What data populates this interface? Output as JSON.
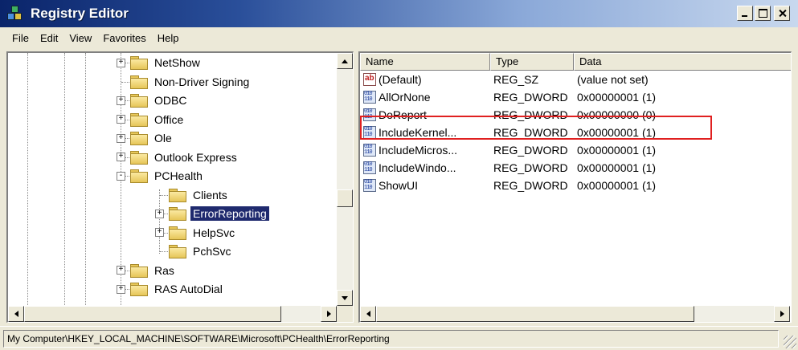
{
  "window": {
    "title": "Registry Editor"
  },
  "menu": [
    "File",
    "Edit",
    "View",
    "Favorites",
    "Help"
  ],
  "tree": {
    "items": [
      {
        "label": "NetShow",
        "expander": "+",
        "level": 0
      },
      {
        "label": "Non-Driver Signing",
        "expander": "",
        "level": 0
      },
      {
        "label": "ODBC",
        "expander": "+",
        "level": 0
      },
      {
        "label": "Office",
        "expander": "+",
        "level": 0
      },
      {
        "label": "Ole",
        "expander": "+",
        "level": 0
      },
      {
        "label": "Outlook Express",
        "expander": "+",
        "level": 0
      },
      {
        "label": "PCHealth",
        "expander": "-",
        "level": 0
      },
      {
        "label": "Clients",
        "expander": "",
        "level": 1
      },
      {
        "label": "ErrorReporting",
        "expander": "+",
        "level": 1,
        "selected": true
      },
      {
        "label": "HelpSvc",
        "expander": "+",
        "level": 1
      },
      {
        "label": "PchSvc",
        "expander": "",
        "level": 1
      },
      {
        "label": "Ras",
        "expander": "+",
        "level": 0
      },
      {
        "label": "RAS AutoDial",
        "expander": "+",
        "level": 0
      }
    ]
  },
  "list": {
    "columns": {
      "name": "Name",
      "type": "Type",
      "data": "Data"
    },
    "rows": [
      {
        "name": "(Default)",
        "type": "REG_SZ",
        "data": "(value not set)",
        "icon": "string-value-icon"
      },
      {
        "name": "AllOrNone",
        "type": "REG_DWORD",
        "data": "0x00000001 (1)",
        "icon": "dword-value-icon"
      },
      {
        "name": "DoReport",
        "type": "REG_DWORD",
        "data": "0x00000000 (0)",
        "icon": "dword-value-icon",
        "highlighted": true
      },
      {
        "name": "IncludeKernel...",
        "type": "REG_DWORD",
        "data": "0x00000001 (1)",
        "icon": "dword-value-icon"
      },
      {
        "name": "IncludeMicros...",
        "type": "REG_DWORD",
        "data": "0x00000001 (1)",
        "icon": "dword-value-icon"
      },
      {
        "name": "IncludeWindo...",
        "type": "REG_DWORD",
        "data": "0x00000001 (1)",
        "icon": "dword-value-icon"
      },
      {
        "name": "ShowUI",
        "type": "REG_DWORD",
        "data": "0x00000001 (1)",
        "icon": "dword-value-icon"
      }
    ]
  },
  "status": {
    "path": "My Computer\\HKEY_LOCAL_MACHINE\\SOFTWARE\\Microsoft\\PCHealth\\ErrorReporting"
  },
  "colors": {
    "selection": "#1f2a6e",
    "highlight_border": "#e02020",
    "titlebar_start": "#0a246a"
  }
}
